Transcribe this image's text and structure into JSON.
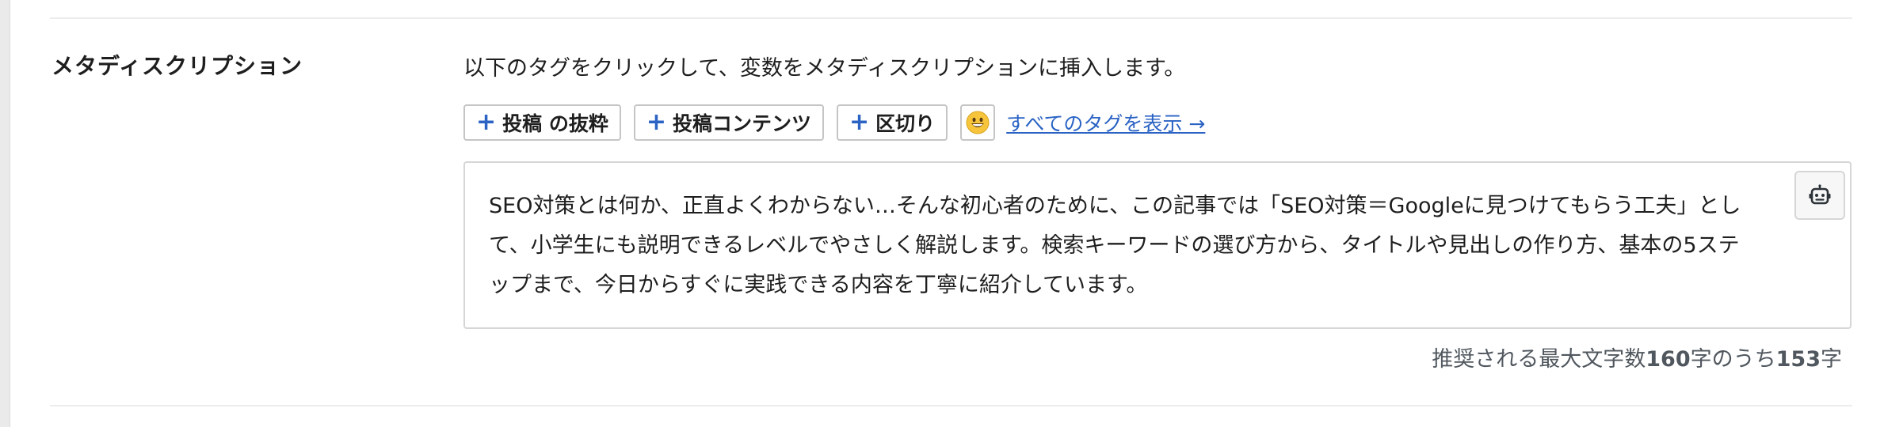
{
  "field": {
    "label": "メタディスクリプション",
    "help_text": "以下のタグをクリックして、変数をメタディスクリプションに挿入します。"
  },
  "tags": {
    "items": [
      {
        "label": "投稿 の抜粋"
      },
      {
        "label": "投稿コンテンツ"
      },
      {
        "label": "区切り"
      }
    ],
    "plus_symbol": "+",
    "emoji_icon": "grinning-face-emoji",
    "show_all_label": "すべてのタグを表示 →"
  },
  "description": {
    "value": "SEO対策とは何か、正直よくわからない…そんな初心者のために、この記事では「SEO対策＝Googleに見つけてもらう工夫」として、小学生にも説明できるレベルでやさしく解説します。検索キーワードの選び方から、タイトルや見出しの作り方、基本の5ステップまで、今日からすぐに実践できる内容を丁寧に紹介しています。"
  },
  "ai_button": {
    "icon": "robot-icon"
  },
  "char_count": {
    "prefix": "推奨される最大文字数",
    "max": "160",
    "middle": "字のうち",
    "current": "153",
    "suffix": "字"
  },
  "colors": {
    "accent": "#2a63c4",
    "text": "#1e1e1e",
    "muted": "#50575e",
    "border": "#c5c5c5"
  }
}
